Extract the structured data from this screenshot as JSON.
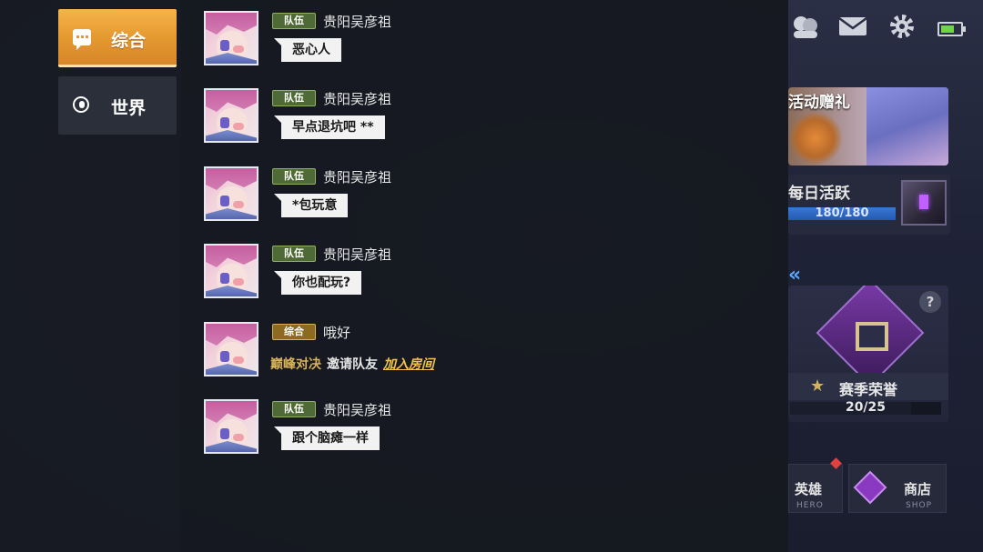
{
  "tabs": [
    {
      "label": "综合",
      "icon": "chat-bubble-icon",
      "active": true
    },
    {
      "label": "世界",
      "icon": "globe-icon",
      "active": false
    }
  ],
  "messages": [
    {
      "channel": "队伍",
      "sender": "贵阳吴彦祖",
      "text": "恶心人"
    },
    {
      "channel": "队伍",
      "sender": "贵阳吴彦祖",
      "text": "早点退坑吧 **"
    },
    {
      "channel": "队伍",
      "sender": "贵阳吴彦祖",
      "text": "*包玩意"
    },
    {
      "channel": "队伍",
      "sender": "贵阳吴彦祖",
      "text": "你也配玩?"
    },
    {
      "channel": "综合",
      "sender": "哦好",
      "system": {
        "mode": "巅峰对决",
        "text": "邀请队友",
        "link": "加入房间"
      }
    },
    {
      "channel": "队伍",
      "sender": "贵阳吴彦祖",
      "text": "跟个脑瘫一样"
    }
  ],
  "background": {
    "event_title": "活动赠礼",
    "daily_title": "每日活跃",
    "daily_progress": "180/180",
    "daily_fraction": 1.0,
    "season_label": "赛季荣誉",
    "season_progress": "20/25",
    "season_fraction": 0.8,
    "help_symbol": "?",
    "collapse_symbol": "«",
    "nav": {
      "hero_zh": "英雄",
      "hero_en": "HERO",
      "shop_zh": "商店",
      "shop_en": "SHOP"
    }
  },
  "colors": {
    "active_tab": "#e59a30",
    "team_badge": "#4f6a36",
    "general_badge": "#8c6a22",
    "link": "#f2c24a",
    "progress_blue": "#3a78d4"
  }
}
